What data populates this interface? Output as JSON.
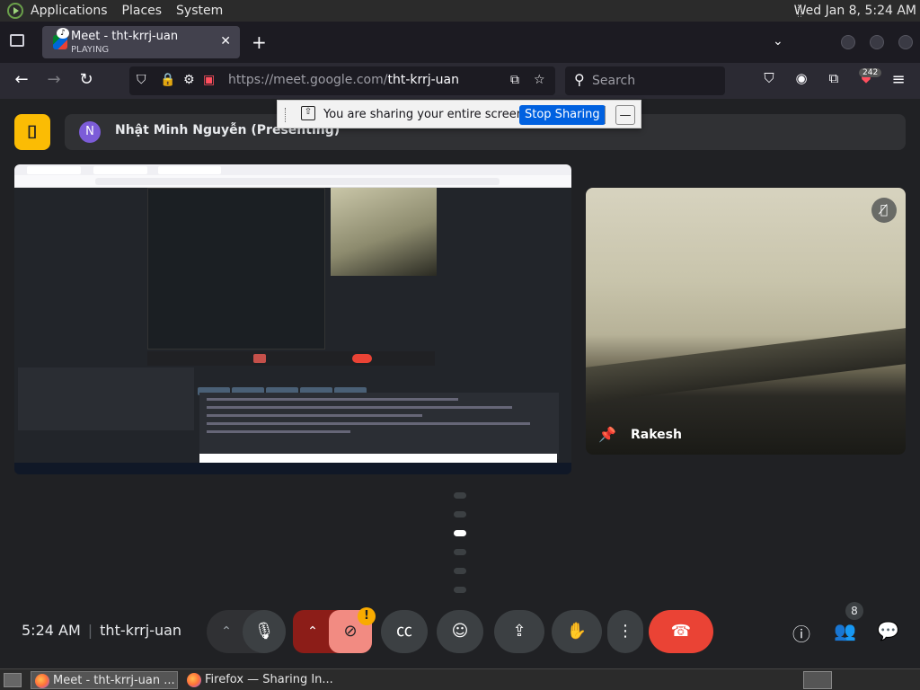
{
  "desktop": {
    "menu": [
      "Applications",
      "Places",
      "System"
    ],
    "clock": "Wed Jan  8,  5:24 AM"
  },
  "browser": {
    "tab": {
      "title": "Meet - tht-krrj-uan",
      "status": "PLAYING",
      "close": "✕"
    },
    "new_tab": "+",
    "url_host": "https://meet.google.com/",
    "url_path": "tht-krrj-uan",
    "search_placeholder": "Search",
    "extensions_badge": "242"
  },
  "share_notice": {
    "message": "You are sharing your entire screen.",
    "stop_label": "Stop Sharing",
    "minimize": "—"
  },
  "meet": {
    "presenter_initial": "N",
    "presenter_label": "Nhật Minh Nguyễn (Presenting)",
    "participant_name": "Rakesh",
    "time": "5:24 AM",
    "meeting_code": "tht-krrj-uan",
    "warning": "!",
    "participant_count": "8"
  },
  "taskbar": {
    "tasks": [
      "Meet - tht-krrj-uan ...",
      "Firefox — Sharing In..."
    ]
  },
  "colors": {
    "meet_bg": "#202124",
    "end_call": "#ea4335",
    "stop_sharing": "#0061e0",
    "meet_logo": "#fbbc04"
  },
  "icons": {
    "back": "arrow-left",
    "forward": "arrow-right",
    "reload": "reload",
    "mic": "microphone",
    "camera_off": "camera-off",
    "captions": "cc",
    "emoji": "smiley",
    "present": "present-screen",
    "raise_hand": "hand",
    "more": "dots-vertical",
    "end_call": "phone-hangup",
    "info": "info",
    "people": "people",
    "chat": "chat"
  }
}
